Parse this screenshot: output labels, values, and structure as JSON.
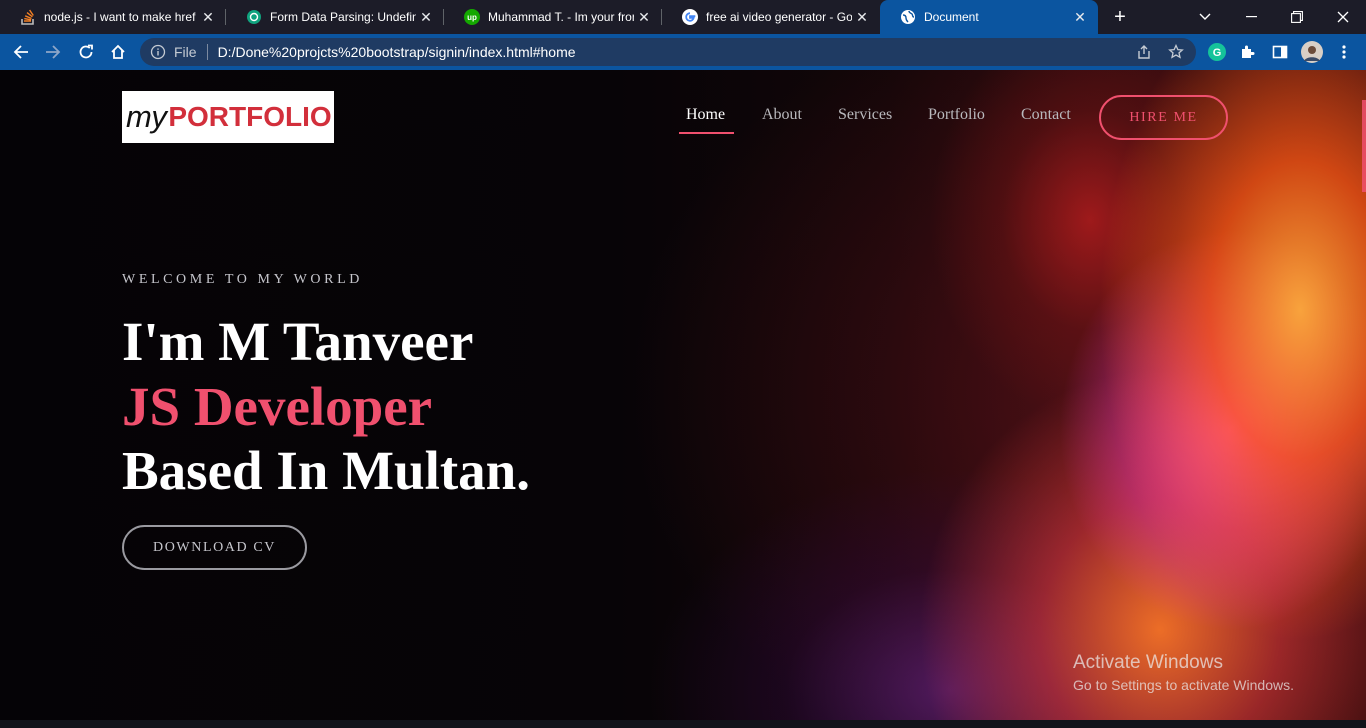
{
  "browser": {
    "tabs": [
      {
        "title": "node.js - I want to make href",
        "icon": "stackoverflow-icon"
      },
      {
        "title": "Form Data Parsing: Undefined",
        "icon": "chatgpt-icon"
      },
      {
        "title": "Muhammad T. - Im your front",
        "icon": "upwork-icon"
      },
      {
        "title": "free ai video generator - Goo",
        "icon": "google-icon"
      },
      {
        "title": "Document",
        "icon": "globe-icon",
        "active": true
      }
    ],
    "new_tab": "+",
    "omnibox": {
      "scheme_label": "File",
      "url": "D:/Done%20projcts%20bootstrap/signin/index.html#home"
    },
    "profile_initial": "G"
  },
  "site": {
    "logo": {
      "my": "my",
      "portfolio": "PORTFOLIO"
    },
    "nav": [
      {
        "label": "Home",
        "active": true
      },
      {
        "label": "About"
      },
      {
        "label": "Services"
      },
      {
        "label": "Portfolio"
      },
      {
        "label": "Contact"
      }
    ],
    "hire_button": "HIRE ME",
    "hero": {
      "welcome": "WELCOME TO MY WORLD",
      "line1": "I'm M Tanveer",
      "line2": "JS Developer",
      "line3": "Based In Multan.",
      "cv_button": "DOWNLOAD CV"
    },
    "colors": {
      "accent": "#f0506e",
      "background": "#050306"
    }
  },
  "windows_watermark": {
    "title": "Activate Windows",
    "subtitle": "Go to Settings to activate Windows."
  }
}
